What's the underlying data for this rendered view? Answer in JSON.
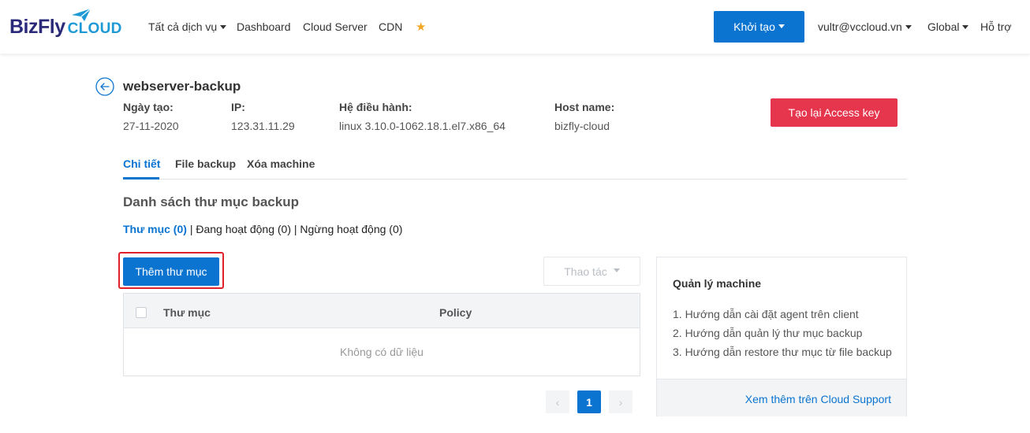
{
  "brand": {
    "name_part1": "BizFly",
    "name_part2": "CLOUD",
    "primary_color": "#2b2a7a",
    "accent_color": "#1d9ad6"
  },
  "nav": {
    "items": [
      {
        "label": "Tất cả dịch vụ",
        "has_caret": true
      },
      {
        "label": "Dashboard"
      },
      {
        "label": "Cloud Server"
      },
      {
        "label": "CDN"
      }
    ],
    "favorite_icon": "star-icon",
    "create_button": "Khởi tạo",
    "account": "vultr@vccloud.vn",
    "region": "Global",
    "support": "Hỗ trợ"
  },
  "machine": {
    "name": "webserver-backup",
    "fields": [
      {
        "label": "Ngày tạo:",
        "value": "27-11-2020"
      },
      {
        "label": "IP:",
        "value": "123.31.11.29"
      },
      {
        "label": "Hệ điều hành:",
        "value": "linux 3.10.0-1062.18.1.el7.x86_64"
      },
      {
        "label": "Host name:",
        "value": "bizfly-cloud"
      }
    ],
    "recreate_key_button": "Tạo lại Access key"
  },
  "tabs": [
    {
      "label": "Chi tiết",
      "active": true
    },
    {
      "label": "File backup",
      "active": false
    },
    {
      "label": "Xóa machine",
      "active": false
    }
  ],
  "folders": {
    "section_title": "Danh sách thư mục backup",
    "filters": {
      "all": "Thư mục (0)",
      "separator": "|",
      "active": "Đang hoạt động (0)",
      "inactive": "Ngừng hoạt động (0)"
    },
    "add_button": "Thêm thư mục",
    "actions_button": "Thao tác",
    "table": {
      "columns": [
        "Thư mục",
        "Policy"
      ],
      "rows": [],
      "empty_text": "Không có dữ liệu"
    },
    "pagination": {
      "prev": "‹",
      "current": "1",
      "next": "›"
    }
  },
  "side_panel": {
    "title": "Quản lý machine",
    "items": [
      "1. Hướng dẫn cài đặt agent trên client",
      "2. Hướng dẫn quản lý thư mục backup",
      "3. Hướng dẫn restore thư mục từ file backup"
    ],
    "footer_link": "Xem thêm trên Cloud Support"
  },
  "colors": {
    "primary": "#0b74d1",
    "danger": "#e6364d",
    "highlight": "#e0212b",
    "star": "#f5a623"
  }
}
